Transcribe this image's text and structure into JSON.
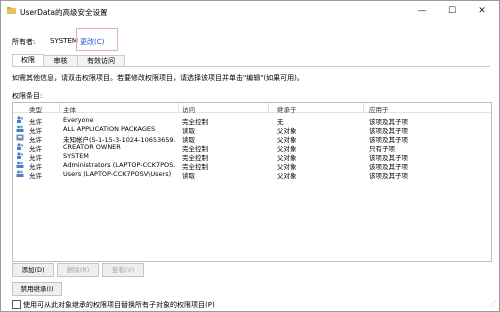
{
  "window": {
    "title": "UserData的高级安全设置",
    "minimize_glyph": "—",
    "maximize_glyph": "☐",
    "close_glyph": "✕"
  },
  "owner": {
    "label": "所有者:",
    "value": "SYSTEM",
    "change_link": "更改(C)"
  },
  "tabs": [
    {
      "label": "权限",
      "active": true
    },
    {
      "label": "审核",
      "active": false
    },
    {
      "label": "有效访问",
      "active": false
    }
  ],
  "description": "如需其他信息，请双击权限项目。若要修改权限项目，请选择该项目并单击\"编辑\"(如果可用)。",
  "list_label": "权限条目:",
  "table": {
    "headers": [
      "类型",
      "主体",
      "访问",
      "继承于",
      "应用于"
    ],
    "rows": [
      {
        "type": "允许",
        "principal": "Everyone",
        "access": "完全控制",
        "inherited": "无",
        "applies": "该项及其子项",
        "icon": "user-icon"
      },
      {
        "type": "允许",
        "principal": "ALL APPLICATION PACKAGES",
        "access": "读取",
        "inherited": "父对象",
        "applies": "该项及其子项",
        "icon": "group-icon"
      },
      {
        "type": "允许",
        "principal": "未知帐户(S-1-15-3-1024-10653659...",
        "access": "读取",
        "inherited": "父对象",
        "applies": "该项及其子项",
        "icon": "unknown-user-icon"
      },
      {
        "type": "允许",
        "principal": "CREATOR OWNER",
        "access": "完全控制",
        "inherited": "父对象",
        "applies": "只有子项",
        "icon": "user-icon"
      },
      {
        "type": "允许",
        "principal": "SYSTEM",
        "access": "完全控制",
        "inherited": "父对象",
        "applies": "该项及其子项",
        "icon": "user-icon"
      },
      {
        "type": "允许",
        "principal": "Administrators (LAPTOP-CCK7POS...",
        "access": "完全控制",
        "inherited": "父对象",
        "applies": "该项及其子项",
        "icon": "group-icon"
      },
      {
        "type": "允许",
        "principal": "Users (LAPTOP-CCK7POSV\\Users)",
        "access": "读取",
        "inherited": "父对象",
        "applies": "该项及其子项",
        "icon": "group-icon"
      }
    ]
  },
  "buttons": {
    "add": "添加(D)",
    "remove": "删除(R)",
    "view": "查看(V)",
    "disable_inheritance": "禁用继承(I)"
  },
  "checkbox": {
    "label": "使用可从此对象继承的权限项目替换所有子对象的权限项目(P)",
    "checked": false
  }
}
